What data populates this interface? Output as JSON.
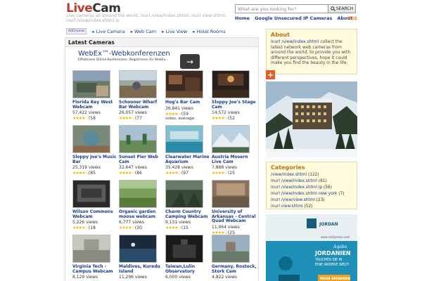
{
  "header": {
    "logo_live": "Live",
    "logo_cam": "Cam",
    "tagline": "Live cameras all around the world, inurl /view/index.shtml, inurl view shtml, inurl /view/index.shtml ip",
    "search_placeholder": "What are you looking for?",
    "search_button": "SEARCH",
    "nav": [
      "Home",
      "Google Unsecured IP Cameras",
      "About"
    ],
    "rss": "RSS"
  },
  "adnav": {
    "adchoices": "AdChoices",
    "links": [
      "Live Camera",
      "Web Cam",
      "Live View",
      "Hotel Rooms"
    ]
  },
  "main": {
    "title": "Latest Cameras",
    "ad_title": "WebEx™-Webkonferenzen",
    "ad_sub": "Effektivere Online-Konferenzen. Registrieren für WebEx -",
    "ad_arrow": "→",
    "cameras": [
      {
        "name": "Florida Key West Webcam",
        "views": "57,422 views",
        "count": "(58",
        "extra": ""
      },
      {
        "name": "Schooner Wharf Bar Webcam",
        "views": "26,057 views",
        "count": "(77",
        "extra": ""
      },
      {
        "name": "Hog's Bar Cam",
        "views": "36,841 views",
        "count": "(59",
        "extra": "votes, average:"
      },
      {
        "name": "Sloppy Joe's Stage Cam",
        "views": "14,572 views",
        "count": "(52",
        "extra": ""
      },
      {
        "name": "Sloppy Joe's Music Bar",
        "views": "25,319 views",
        "count": "(85",
        "extra": ""
      },
      {
        "name": "Sunset Pier Web Cam",
        "views": "32,647 views",
        "count": "(86",
        "extra": ""
      },
      {
        "name": "Clearwater Marine Aquarium",
        "views": "35,428 views",
        "count": "(97",
        "extra": ""
      },
      {
        "name": "Austria Mosern Live Cam",
        "views": "7,888 views",
        "count": "(25",
        "extra": ""
      },
      {
        "name": "Wilson Commons Webcam",
        "views": "5,226 views",
        "count": "(18",
        "extra": ""
      },
      {
        "name": "Organic garden moose webcam",
        "views": "6,777 views",
        "count": "(30",
        "extra": ""
      },
      {
        "name": "Charm Country Camping Webcam",
        "views": "9,131 views",
        "count": "(15",
        "extra": ""
      },
      {
        "name": "University of Arkansas - Central Quad Webcam",
        "views": "11,964 views",
        "count": "(25",
        "extra": ""
      },
      {
        "name": "Virginia Tech - Campus Webcam",
        "views": "8,129 views",
        "count": "",
        "extra": ""
      },
      {
        "name": "Maldives, Kuredu Island",
        "views": "11,296 views",
        "count": "",
        "extra": ""
      },
      {
        "name": "Taiwan,Lulin Observatory",
        "views": "6,000 views",
        "count": "",
        "extra": ""
      },
      {
        "name": "Germany, Rostock, Stork Cam",
        "views": "4,822 views",
        "count": "",
        "extra": ""
      }
    ]
  },
  "about": {
    "title": "About",
    "link": "inurl /view/index.shtml",
    "text": " collect the latest network web cameras from around the world, to provide you with different perspectives, hope it could make you find the beauty in the life."
  },
  "plus": "+",
  "categories": {
    "title": "Categories",
    "items": [
      {
        "label": "/view/index.shtml",
        "count": " (122)"
      },
      {
        "label": "inurl /view/index.shtml",
        "count": " (81)"
      },
      {
        "label": "inurl /view/index.shtml ip",
        "count": " (56)"
      },
      {
        "label": "inurl /view/index.shtml new york",
        "count": " (7)"
      },
      {
        "label": "inurl /view/view.shtml",
        "count": " (23)"
      },
      {
        "label": "inurl view.shtml",
        "count": " (52)"
      }
    ]
  },
  "side_ad": {
    "brand": "JORDAN",
    "site": "www.visitjordan.com",
    "place": "Aqaba",
    "line1": "JORDANIEN",
    "line2": "TAUCHEN SIE IN",
    "line3": "EINE ANDERE WELT!",
    "cta": "MEHR ERFAHREN"
  },
  "colors": {
    "accent": "#c0392b",
    "link": "#1a3c8c",
    "box_bg": "#fffbdc",
    "box_title": "#c0701b",
    "star": "#f0b400"
  }
}
